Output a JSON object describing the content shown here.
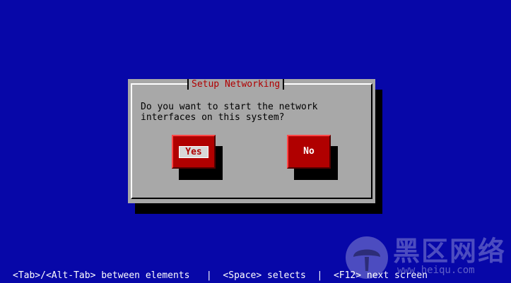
{
  "dialog": {
    "title": "Setup Networking",
    "message_line1": "Do you want to start the network",
    "message_line2": "interfaces on this system?",
    "buttons": {
      "yes": "Yes",
      "no": "No"
    }
  },
  "footer": {
    "help_text": "<Tab>/<Alt-Tab> between elements   |  <Space> selects  |  <F12> next screen"
  },
  "watermark": {
    "brand": "黑区网络",
    "url": "www.heiqu.com"
  },
  "colors": {
    "background": "#0707a8",
    "dialog": "#a8a8a8",
    "title_text": "#b00000",
    "button": "#b00000"
  }
}
